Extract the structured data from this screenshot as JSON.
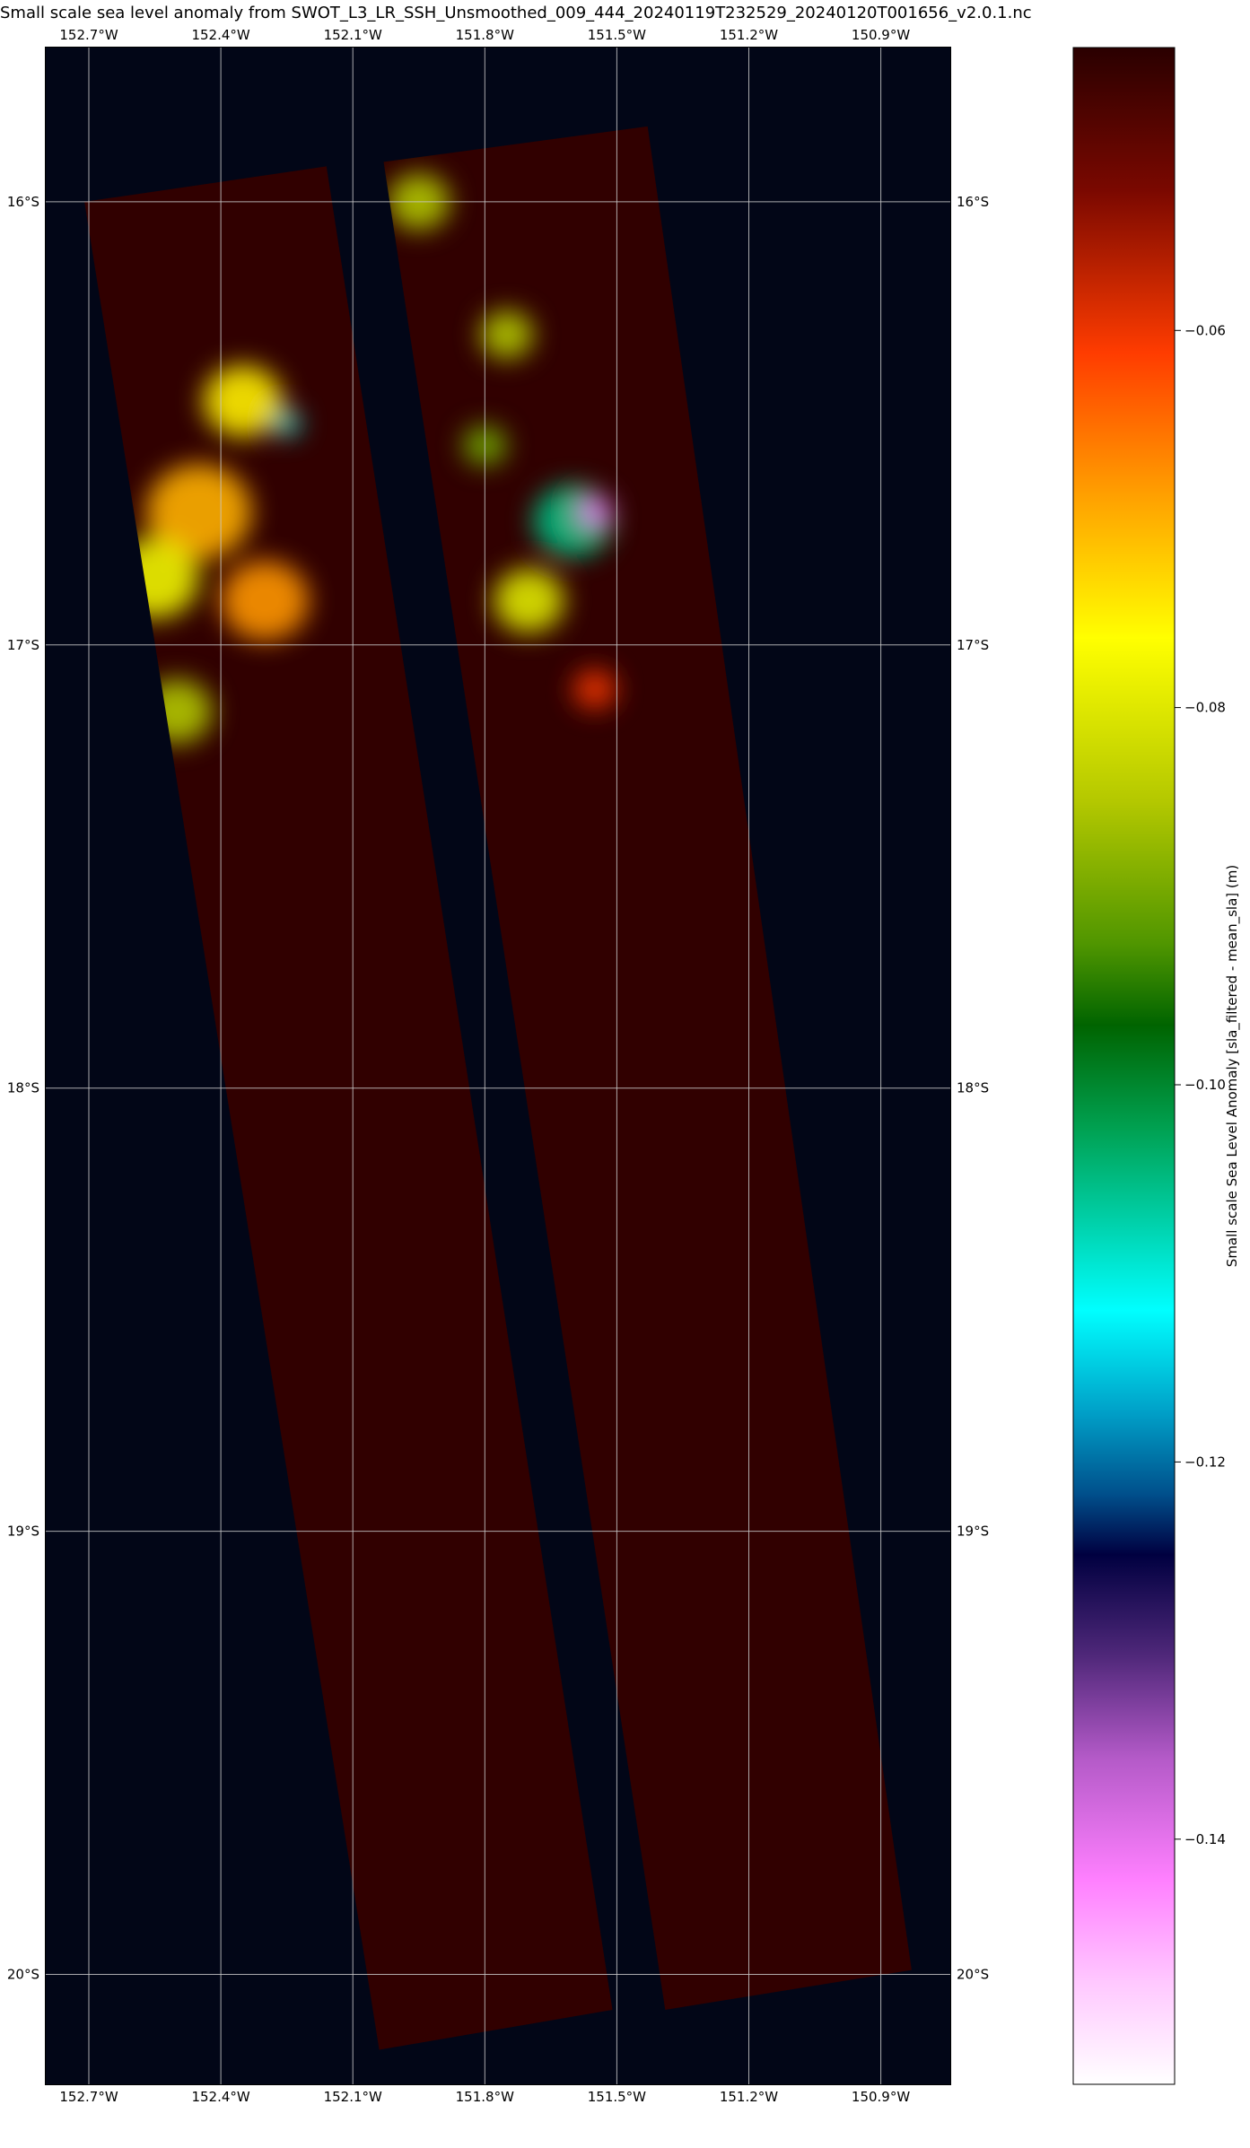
{
  "title": "Small scale sea level anomaly from SWOT_L3_LR_SSH_Unsmoothed_009_444_20240119T232529_20240120T001656_v2.0.1.nc",
  "map": {
    "background_color": "#020617",
    "gridline_color": "#c8c8c8",
    "lon_range": [
      -152.8,
      -150.74
    ],
    "lat_range": [
      -20.25,
      -15.65
    ],
    "lon_ticks": [
      {
        "value": -152.7,
        "label": "152.7°W"
      },
      {
        "value": -152.4,
        "label": "152.4°W"
      },
      {
        "value": -152.1,
        "label": "152.1°W"
      },
      {
        "value": -151.8,
        "label": "151.8°W"
      },
      {
        "value": -151.5,
        "label": "151.5°W"
      },
      {
        "value": -151.2,
        "label": "151.2°W"
      },
      {
        "value": -150.9,
        "label": "150.9°W"
      }
    ],
    "lat_ticks": [
      {
        "value": -16,
        "label": "16°S"
      },
      {
        "value": -17,
        "label": "17°S"
      },
      {
        "value": -18,
        "label": "18°S"
      },
      {
        "value": -19,
        "label": "19°S"
      },
      {
        "value": -20,
        "label": "20°S"
      }
    ],
    "swaths": [
      {
        "name": "left-swath",
        "corners_lonlat": [
          [
            -152.71,
            -16.0
          ],
          [
            -152.16,
            -15.92
          ],
          [
            -151.51,
            -20.08
          ],
          [
            -152.04,
            -20.17
          ]
        ]
      },
      {
        "name": "right-swath",
        "corners_lonlat": [
          [
            -152.03,
            -15.91
          ],
          [
            -151.43,
            -15.83
          ],
          [
            -150.83,
            -19.99
          ],
          [
            -151.39,
            -20.08
          ]
        ]
      }
    ],
    "swath_base_color": "#310000"
  },
  "colorbar": {
    "label": "Small scale Sea Level Anomaly [sla_filtered - mean_sla] (m)",
    "vmin": -0.153,
    "vmax": -0.045,
    "ticks": [
      {
        "value": -0.06,
        "label": "−0.06"
      },
      {
        "value": -0.08,
        "label": "−0.08"
      },
      {
        "value": -0.1,
        "label": "−0.10"
      },
      {
        "value": -0.12,
        "label": "−0.12"
      },
      {
        "value": -0.14,
        "label": "−0.14"
      }
    ],
    "stops": [
      {
        "offset": 0.0,
        "color": "#2a0000"
      },
      {
        "offset": 0.07,
        "color": "#7a0800"
      },
      {
        "offset": 0.15,
        "color": "#ff3c00"
      },
      {
        "offset": 0.22,
        "color": "#ffa000"
      },
      {
        "offset": 0.29,
        "color": "#ffff00"
      },
      {
        "offset": 0.37,
        "color": "#b4c800"
      },
      {
        "offset": 0.44,
        "color": "#509600"
      },
      {
        "offset": 0.48,
        "color": "#006400"
      },
      {
        "offset": 0.53,
        "color": "#00a050"
      },
      {
        "offset": 0.58,
        "color": "#00d4b0"
      },
      {
        "offset": 0.62,
        "color": "#00ffff"
      },
      {
        "offset": 0.67,
        "color": "#00a0c8"
      },
      {
        "offset": 0.71,
        "color": "#00508c"
      },
      {
        "offset": 0.74,
        "color": "#000040"
      },
      {
        "offset": 0.79,
        "color": "#50287a"
      },
      {
        "offset": 0.84,
        "color": "#b45ac8"
      },
      {
        "offset": 0.9,
        "color": "#ff80ff"
      },
      {
        "offset": 0.95,
        "color": "#ffc8ff"
      },
      {
        "offset": 1.0,
        "color": "#ffffff"
      }
    ]
  },
  "anomaly_features": [
    {
      "lon": -152.35,
      "lat": -16.45,
      "value": -0.075,
      "r": 0.09
    },
    {
      "lon": -152.45,
      "lat": -16.7,
      "value": -0.07,
      "r": 0.12
    },
    {
      "lon": -152.55,
      "lat": -16.85,
      "value": -0.078,
      "r": 0.1
    },
    {
      "lon": -152.5,
      "lat": -17.15,
      "value": -0.085,
      "r": 0.08
    },
    {
      "lon": -152.3,
      "lat": -16.9,
      "value": -0.068,
      "r": 0.1
    },
    {
      "lon": -152.25,
      "lat": -16.5,
      "value": -0.11,
      "r": 0.03
    },
    {
      "lon": -151.95,
      "lat": -16.0,
      "value": -0.085,
      "r": 0.07
    },
    {
      "lon": -151.75,
      "lat": -16.3,
      "value": -0.085,
      "r": 0.06
    },
    {
      "lon": -151.6,
      "lat": -16.72,
      "value": -0.105,
      "r": 0.09
    },
    {
      "lon": -151.55,
      "lat": -16.7,
      "value": -0.14,
      "r": 0.04
    },
    {
      "lon": -151.7,
      "lat": -16.9,
      "value": -0.08,
      "r": 0.08
    },
    {
      "lon": -151.8,
      "lat": -16.55,
      "value": -0.09,
      "r": 0.05
    },
    {
      "lon": -151.55,
      "lat": -17.1,
      "value": -0.06,
      "r": 0.05
    }
  ]
}
